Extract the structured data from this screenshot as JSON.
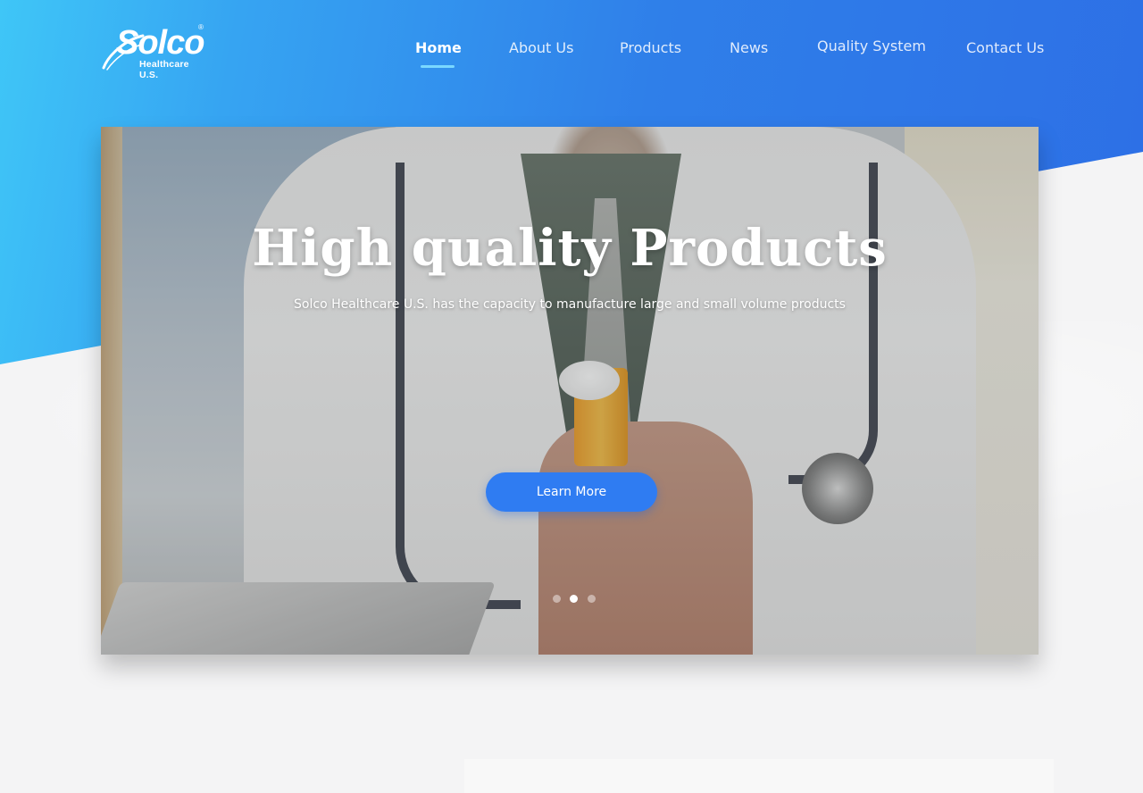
{
  "brand": {
    "name": "Solco",
    "subtitle": "Healthcare U.S.",
    "registered": "®"
  },
  "nav": {
    "items": [
      {
        "label": "Home",
        "active": true
      },
      {
        "label": "About Us",
        "active": false
      },
      {
        "label": "Products",
        "active": false
      },
      {
        "label": "News",
        "active": false
      },
      {
        "label": "Quality System",
        "active": false
      },
      {
        "label": "Contact Us",
        "active": false
      }
    ]
  },
  "hero": {
    "title": "High quality Products",
    "subtitle": "Solco Healthcare U.S. has the capacity to manufacture large and small volume products",
    "cta_label": "Learn More",
    "slides_total": 3,
    "active_slide": 2
  },
  "colors": {
    "accent": "#2f7cf2",
    "header_gradient_start": "#3fc6f7",
    "header_gradient_end": "#2d6fe6",
    "nav_underline": "#7ad8ff"
  }
}
